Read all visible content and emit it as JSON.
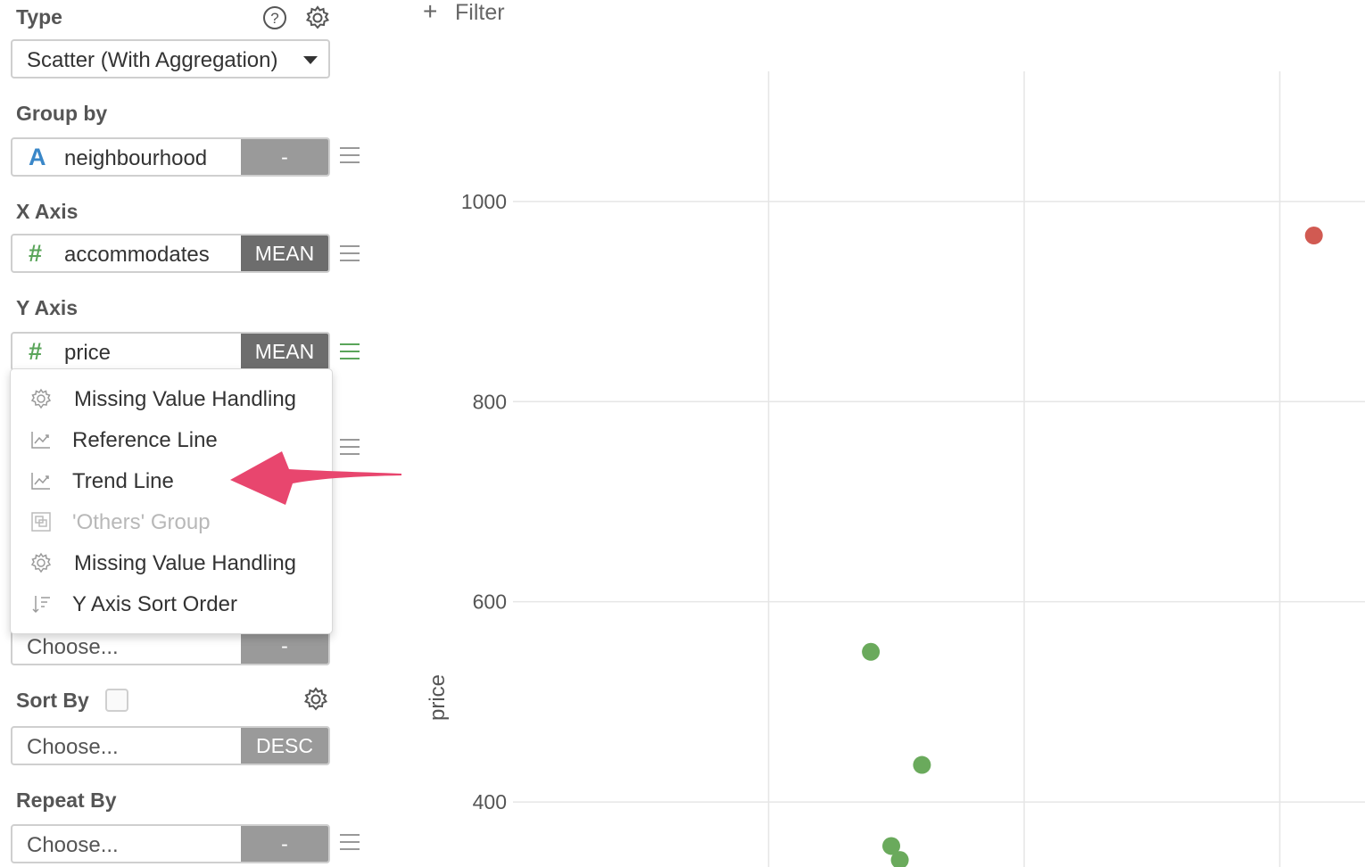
{
  "sidebar": {
    "type_label": "Type",
    "type_value": "Scatter (With Aggregation)",
    "group_by_label": "Group by",
    "group_by_field": "neighbourhood",
    "group_by_agg": "-",
    "x_axis_label": "X Axis",
    "x_axis_field": "accommodates",
    "x_axis_agg": "MEAN",
    "y_axis_label": "Y Axis",
    "y_axis_field": "price",
    "y_axis_agg": "MEAN",
    "hidden_pill_placeholder": "Choose...",
    "hidden_pill_agg": "-",
    "sort_by_label": "Sort By",
    "sort_by_placeholder": "Choose...",
    "sort_by_agg": "DESC",
    "repeat_by_label": "Repeat By",
    "repeat_by_placeholder": "Choose...",
    "repeat_by_agg": "-"
  },
  "menu": {
    "items": [
      {
        "label": "Missing Value Handling",
        "icon": "gear-icon",
        "disabled": false
      },
      {
        "label": "Reference Line",
        "icon": "line-chart-icon",
        "disabled": false
      },
      {
        "label": "Trend Line",
        "icon": "line-chart-icon",
        "disabled": false
      },
      {
        "label": "'Others' Group",
        "icon": "group-icon",
        "disabled": true
      },
      {
        "label": "Missing Value Handling",
        "icon": "gear-icon",
        "disabled": false
      },
      {
        "label": "Y Axis Sort Order",
        "icon": "sort-icon",
        "disabled": false
      }
    ]
  },
  "filter": {
    "label": "Filter"
  },
  "annotation": {
    "color": "#e8466e",
    "target": "Trend Line"
  },
  "colors": {
    "point_green": "#6aaa5c",
    "point_red": "#d15a52",
    "accent_green": "#5aa55a"
  },
  "chart_data": {
    "type": "scatter",
    "xlabel": "",
    "ylabel": "price",
    "ylim": [
      335,
      1130
    ],
    "yticks": [
      400,
      600,
      800,
      1000
    ],
    "grid": true,
    "series": [
      {
        "color": "#d15a52",
        "points": [
          {
            "x": 5.7,
            "y": 966
          }
        ]
      },
      {
        "color": "#6aaa5c",
        "points": [
          {
            "x": 3.1,
            "y": 550
          },
          {
            "x": 3.4,
            "y": 437
          },
          {
            "x": 3.22,
            "y": 356
          },
          {
            "x": 3.27,
            "y": 342
          }
        ]
      }
    ],
    "xlim": [
      1.0,
      6.0
    ],
    "xgrid": [
      2.5,
      4.0,
      5.5
    ]
  }
}
